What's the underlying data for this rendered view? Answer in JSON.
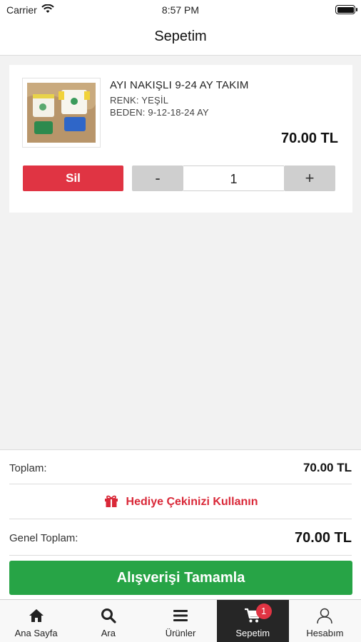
{
  "status_bar": {
    "carrier": "Carrier",
    "time": "8:57 PM"
  },
  "nav": {
    "title": "Sepetim"
  },
  "cart_item": {
    "name": "AYI NAKIŞLI 9-24 AY TAKIM",
    "color": "RENK: YEŞİL",
    "size": "BEDEN: 9-12-18-24 AY",
    "price": "70.00 TL",
    "delete_label": "Sil",
    "decrement_label": "-",
    "quantity": "1",
    "increment_label": "+"
  },
  "summary": {
    "subtotal_label": "Toplam:",
    "subtotal_value": "70.00 TL",
    "gift_label": "Hediye Çekinizi Kullanın",
    "total_label": "Genel Toplam:",
    "total_value": "70.00 TL",
    "checkout_label": "Alışverişi Tamamla"
  },
  "tab_bar": {
    "items": [
      {
        "label": "Ana Sayfa",
        "icon": "home-icon"
      },
      {
        "label": "Ara",
        "icon": "search-icon"
      },
      {
        "label": "Ürünler",
        "icon": "menu-icon"
      },
      {
        "label": "Sepetim",
        "icon": "cart-icon",
        "active": true,
        "badge": "1"
      },
      {
        "label": "Hesabım",
        "icon": "user-icon"
      }
    ]
  },
  "colors": {
    "delete": "#e03443",
    "checkout": "#27a446",
    "gift": "#d92838",
    "active_tab": "#262626",
    "badge": "#e03443"
  }
}
